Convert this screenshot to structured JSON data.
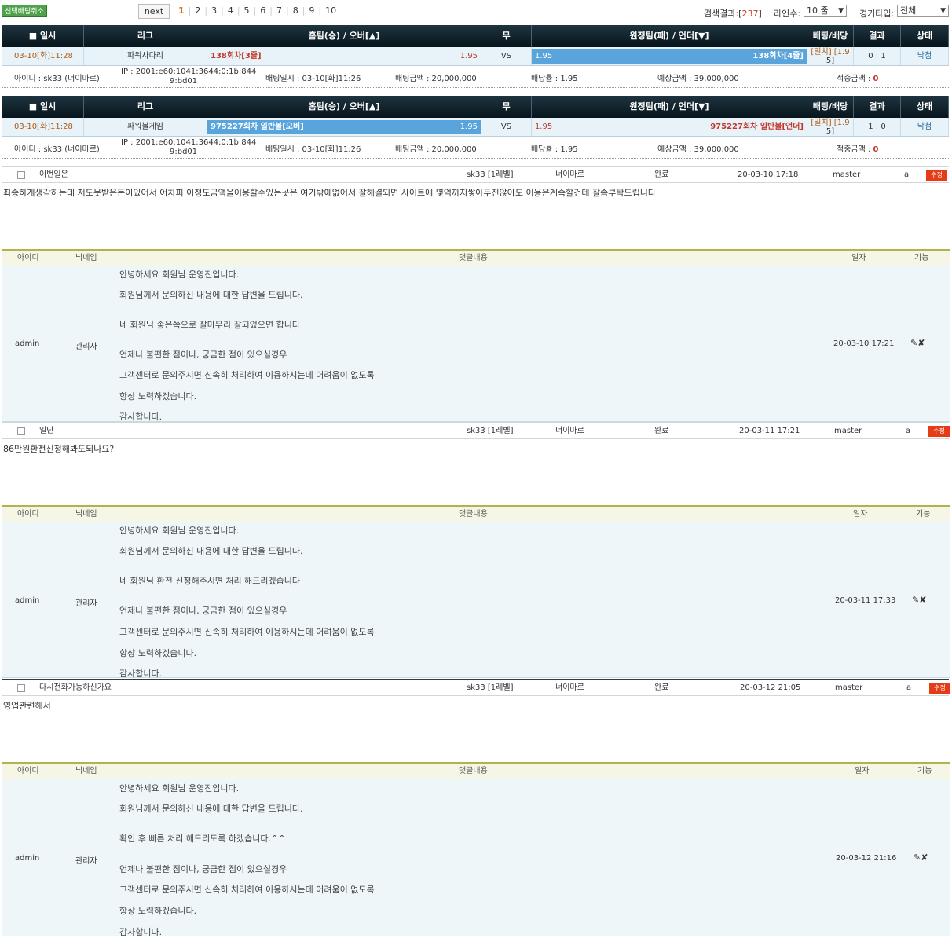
{
  "top": {
    "cancel": "선택배팅취소",
    "next": "next",
    "pages": [
      "1",
      "2",
      "3",
      "4",
      "5",
      "6",
      "7",
      "8",
      "9",
      "10"
    ],
    "search_label": "검색결과:[",
    "search_count": "237",
    "search_close": "]",
    "lines_label": "라인수:",
    "lines_value": "10 줄",
    "gtype_label": "경기타입:",
    "gtype_value": "전체"
  },
  "head": {
    "date": "일시",
    "league": "리그",
    "home": "홈팀(승) / 오버[▲]",
    "draw": "무",
    "away": "원정팀(패) / 언더[▼]",
    "odds": "배팅/배당",
    "result": "결과",
    "status": "상태"
  },
  "bets": [
    {
      "date": "03-10[화]11:28",
      "league": "파워사다리",
      "home": "138회차[3줄]",
      "home_odds": "1.95",
      "vs": "VS",
      "away_odds": "1.95",
      "away": "138회차[4줄]",
      "odds_l1": "[일치] [1.9",
      "odds_l2": "5]",
      "result": "0 : 1",
      "status": "낙첨",
      "id": "아이디 : sk33 (너이마르)",
      "ip1": "IP : 2001:e60:1041:3644:0:1b:844",
      "ip2": "9:bd01",
      "bet_time": "배팅일시 : 03-10[화]11:26",
      "amount": "배팅금액 : 20,000,000",
      "rate": "배당률 : 1.95",
      "expected": "예상금액 : 39,000,000",
      "hit_label": "적중금액 :",
      "hit": "0"
    },
    {
      "date": "03-10[화]11:28",
      "league": "파워볼게임",
      "home": "975227회차 일반볼[오버]",
      "home_odds": "1.95",
      "vs": "VS",
      "away_odds": "1.95",
      "away": "975227회차 일반볼[언더]",
      "odds_l1": "[일치] [1.9",
      "odds_l2": "5]",
      "result": "1 : 0",
      "status": "낙첨",
      "id": "아이디 : sk33 (너이마르)",
      "ip1": "IP : 2001:e60:1041:3644:0:1b:844",
      "ip2": "9:bd01",
      "bet_time": "배팅일시 : 03-10[화]11:26",
      "amount": "배팅금액 : 20,000,000",
      "rate": "배당률 : 1.95",
      "expected": "예상금액 : 39,000,000",
      "hit_label": "적중금액 :",
      "hit": "0"
    }
  ],
  "chead": {
    "id": "아이디",
    "nick": "닉네임",
    "content": "댓글내용",
    "date": "일자",
    "func": "기능"
  },
  "posts": [
    {
      "title": "이번일은",
      "user": "sk33 [1레벨]",
      "nick": "너이마르",
      "state": "완료",
      "date": "20-03-10 17:18",
      "writer": "master",
      "a": "a",
      "edit": "수정",
      "text": "죄송하게생각하는데 저도못받은돈이있어서 어차피 이정도금액을이용할수있는곳은 여기밖에없어서 잘해결되면 사이트에 몇억까지쌓아두진않아도 이용은계속할건데 잘좀부탁드립니다",
      "c_id": "admin",
      "c_nick": "관리자",
      "c_date": "20-03-10 17:21",
      "lines": [
        "안녕하세요 회원님 운영진입니다.",
        "회원님께서 문의하신 내용에 대한 답변을 드립니다.",
        "네 회원님 좋은쪽으로 잘마무리 잘되었으면 합니다",
        "언제나 불편한 점이나, 궁금한 점이 있으실경우",
        "고객센터로 문의주시면 신속히 처리하여 이용하시는데 어려움이 없도록",
        "항상 노력하겠습니다.",
        "감사합니다."
      ]
    },
    {
      "title": "일단",
      "user": "sk33 [1레벨]",
      "nick": "너이마르",
      "state": "완료",
      "date": "20-03-11 17:21",
      "writer": "master",
      "a": "a",
      "edit": "수정",
      "text": "86만원환전신청해봐도되나요?",
      "c_id": "admin",
      "c_nick": "관리자",
      "c_date": "20-03-11 17:33",
      "lines": [
        "안녕하세요 회원님 운영진입니다.",
        "회원님께서 문의하신 내용에 대한 답변을 드립니다.",
        "네 회원님 환전 신청해주시면 처리 해드리겠습니다",
        "언제나 불편한 점이나, 궁금한 점이 있으실경우",
        "고객센터로 문의주시면 신속히 처리하여 이용하시는데 어려움이 없도록",
        "항상 노력하겠습니다.",
        "감사합니다."
      ]
    },
    {
      "title": "다시전화가능하신가요",
      "user": "sk33 [1레벨]",
      "nick": "너이마르",
      "state": "완료",
      "date": "20-03-12 21:05",
      "writer": "master",
      "a": "a",
      "edit": "수정",
      "text": "영업관련해서",
      "c_id": "admin",
      "c_nick": "관리자",
      "c_date": "20-03-12 21:16",
      "lines": [
        "안녕하세요 회원님 운영진입니다.",
        "회원님께서 문의하신 내용에 대한 답변을 드립니다.",
        "확인 후 빠른 처리 해드리도록 하겠습니다.^^",
        "언제나 불편한 점이나, 궁금한 점이 있으실경우",
        "고객센터로 문의주시면 신속히 처리하여 이용하시는데 어려움이 없도록",
        "항상 노력하겠습니다.",
        "감사합니다."
      ]
    }
  ],
  "colors": {
    "accent": "#e36c09",
    "header_bg": "#0f2530",
    "row_bg": "#e8f3f9",
    "selected": "#5aa4dc",
    "edit": "#e53b16"
  }
}
